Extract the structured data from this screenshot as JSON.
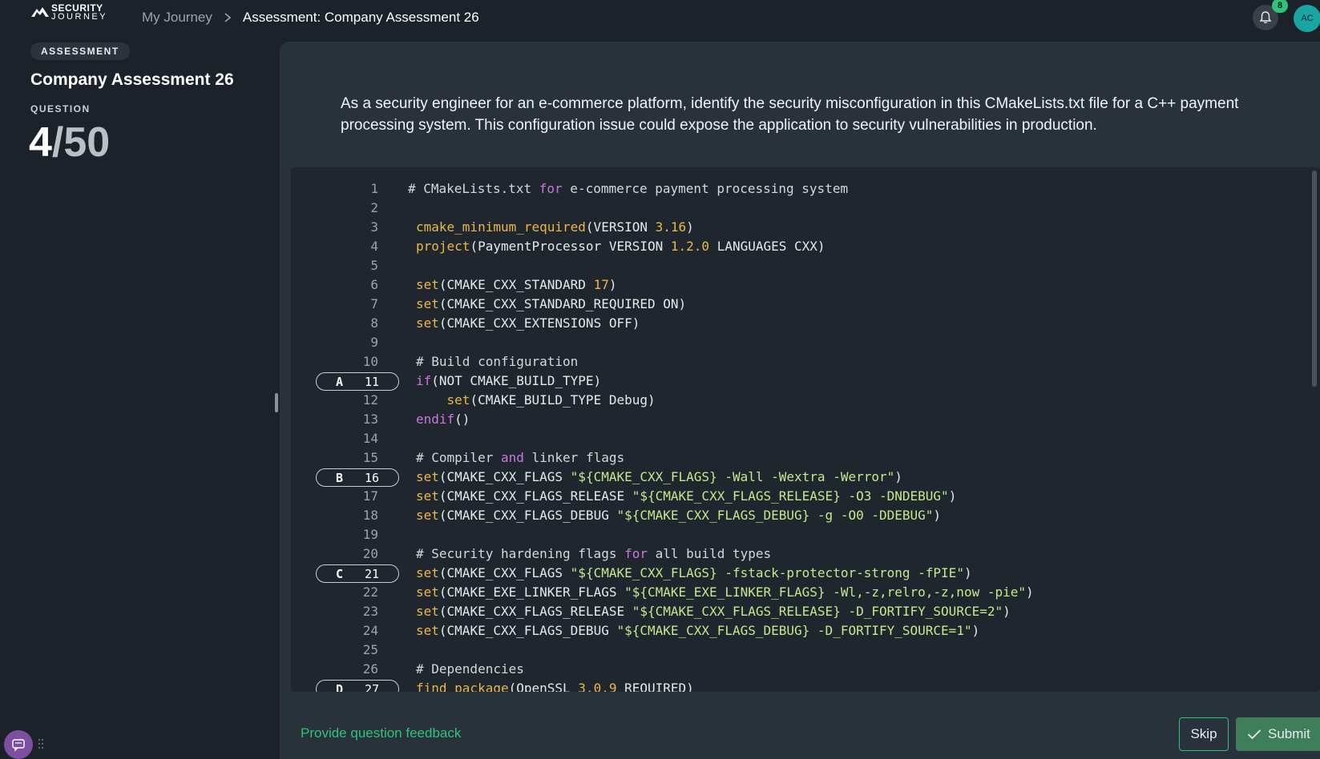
{
  "header": {
    "logo_line1": "SECURITY",
    "logo_line2": "JOURNEY",
    "breadcrumb_home": "My Journey",
    "breadcrumb_current": "Assessment: Company Assessment 26",
    "notification_count": "8",
    "avatar_initials": "AC"
  },
  "sidebar": {
    "badge": "ASSESSMENT",
    "title": "Company Assessment 26",
    "question_label": "QUESTION",
    "question_current": "4",
    "question_total": "/50"
  },
  "question": {
    "prompt": "As a security engineer for an e-commerce platform, identify the security misconfiguration in this CMakeLists.txt file for a C++ payment processing system. This configuration issue could expose the application to security vulnerabilities in production."
  },
  "code": {
    "lines": [
      {
        "n": "1",
        "tokens": [
          [
            "cm",
            "# CMakeLists.txt "
          ],
          [
            "kw",
            "for"
          ],
          [
            "cm",
            " e-commerce payment processing system"
          ]
        ],
        "shift": -10
      },
      {
        "n": "2",
        "tokens": []
      },
      {
        "n": "3",
        "tokens": [
          [
            "fn",
            "cmake_minimum_required"
          ],
          [
            "pl",
            "(VERSION "
          ],
          [
            "num",
            "3.16"
          ],
          [
            "pl",
            ")"
          ]
        ]
      },
      {
        "n": "4",
        "tokens": [
          [
            "fn",
            "project"
          ],
          [
            "pl",
            "(PaymentProcessor VERSION "
          ],
          [
            "num",
            "1.2.0"
          ],
          [
            "pl",
            " LANGUAGES CXX)"
          ]
        ]
      },
      {
        "n": "5",
        "tokens": []
      },
      {
        "n": "6",
        "tokens": [
          [
            "fn",
            "set"
          ],
          [
            "pl",
            "(CMAKE_CXX_STANDARD "
          ],
          [
            "num",
            "17"
          ],
          [
            "pl",
            ")"
          ]
        ]
      },
      {
        "n": "7",
        "tokens": [
          [
            "fn",
            "set"
          ],
          [
            "pl",
            "(CMAKE_CXX_STANDARD_REQUIRED ON)"
          ]
        ]
      },
      {
        "n": "8",
        "tokens": [
          [
            "fn",
            "set"
          ],
          [
            "pl",
            "(CMAKE_CXX_EXTENSIONS OFF)"
          ]
        ]
      },
      {
        "n": "9",
        "tokens": []
      },
      {
        "n": "10",
        "tokens": [
          [
            "cm",
            "# Build configuration"
          ]
        ]
      },
      {
        "n": "11",
        "option": "A",
        "tokens": [
          [
            "kw",
            "if"
          ],
          [
            "pl",
            "(NOT CMAKE_BUILD_TYPE)"
          ]
        ]
      },
      {
        "n": "12",
        "tokens": [
          [
            "pl",
            "    "
          ],
          [
            "fn",
            "set"
          ],
          [
            "pl",
            "(CMAKE_BUILD_TYPE Debug)"
          ]
        ]
      },
      {
        "n": "13",
        "tokens": [
          [
            "kw",
            "endif"
          ],
          [
            "pl",
            "()"
          ]
        ]
      },
      {
        "n": "14",
        "tokens": []
      },
      {
        "n": "15",
        "tokens": [
          [
            "cm",
            "# Compiler "
          ],
          [
            "kw",
            "and"
          ],
          [
            "cm",
            " linker flags"
          ]
        ]
      },
      {
        "n": "16",
        "option": "B",
        "tokens": [
          [
            "fn",
            "set"
          ],
          [
            "pl",
            "(CMAKE_CXX_FLAGS "
          ],
          [
            "str",
            "\"${CMAKE_CXX_FLAGS} -Wall -Wextra -Werror\""
          ],
          [
            "pl",
            ")"
          ]
        ]
      },
      {
        "n": "17",
        "tokens": [
          [
            "fn",
            "set"
          ],
          [
            "pl",
            "(CMAKE_CXX_FLAGS_RELEASE "
          ],
          [
            "str",
            "\"${CMAKE_CXX_FLAGS_RELEASE} -O3 -DNDEBUG\""
          ],
          [
            "pl",
            ")"
          ]
        ]
      },
      {
        "n": "18",
        "tokens": [
          [
            "fn",
            "set"
          ],
          [
            "pl",
            "(CMAKE_CXX_FLAGS_DEBUG "
          ],
          [
            "str",
            "\"${CMAKE_CXX_FLAGS_DEBUG} -g -O0 -DDEBUG\""
          ],
          [
            "pl",
            ")"
          ]
        ]
      },
      {
        "n": "19",
        "tokens": []
      },
      {
        "n": "20",
        "tokens": [
          [
            "cm",
            "# Security hardening flags "
          ],
          [
            "kw",
            "for"
          ],
          [
            "cm",
            " all build types"
          ]
        ]
      },
      {
        "n": "21",
        "option": "C",
        "tokens": [
          [
            "fn",
            "set"
          ],
          [
            "pl",
            "(CMAKE_CXX_FLAGS "
          ],
          [
            "str",
            "\"${CMAKE_CXX_FLAGS} -fstack-protector-strong -fPIE\""
          ],
          [
            "pl",
            ")"
          ]
        ]
      },
      {
        "n": "22",
        "tokens": [
          [
            "fn",
            "set"
          ],
          [
            "pl",
            "(CMAKE_EXE_LINKER_FLAGS "
          ],
          [
            "str",
            "\"${CMAKE_EXE_LINKER_FLAGS} -Wl,-z,relro,-z,now -pie\""
          ],
          [
            "pl",
            ")"
          ]
        ]
      },
      {
        "n": "23",
        "tokens": [
          [
            "fn",
            "set"
          ],
          [
            "pl",
            "(CMAKE_CXX_FLAGS_RELEASE "
          ],
          [
            "str",
            "\"${CMAKE_CXX_FLAGS_RELEASE} -D_FORTIFY_SOURCE=2\""
          ],
          [
            "pl",
            ")"
          ]
        ]
      },
      {
        "n": "24",
        "tokens": [
          [
            "fn",
            "set"
          ],
          [
            "pl",
            "(CMAKE_CXX_FLAGS_DEBUG "
          ],
          [
            "str",
            "\"${CMAKE_CXX_FLAGS_DEBUG} -D_FORTIFY_SOURCE=1\""
          ],
          [
            "pl",
            ")"
          ]
        ]
      },
      {
        "n": "25",
        "tokens": []
      },
      {
        "n": "26",
        "tokens": [
          [
            "cm",
            "# Dependencies"
          ]
        ]
      },
      {
        "n": "27",
        "option": "D",
        "tokens": [
          [
            "fn",
            "find_package"
          ],
          [
            "pl",
            "(OpenSSL "
          ],
          [
            "num",
            "3.0.9"
          ],
          [
            "pl",
            " REQUIRED)"
          ]
        ]
      }
    ]
  },
  "footer": {
    "feedback_link": "Provide question feedback",
    "skip_label": "Skip",
    "submit_label": "Submit"
  },
  "colors": {
    "accent_green": "#2fc27a",
    "keyword": "#c678dd",
    "function": "#e8b84a",
    "string": "#c3e88d",
    "background": "#1c2229"
  }
}
